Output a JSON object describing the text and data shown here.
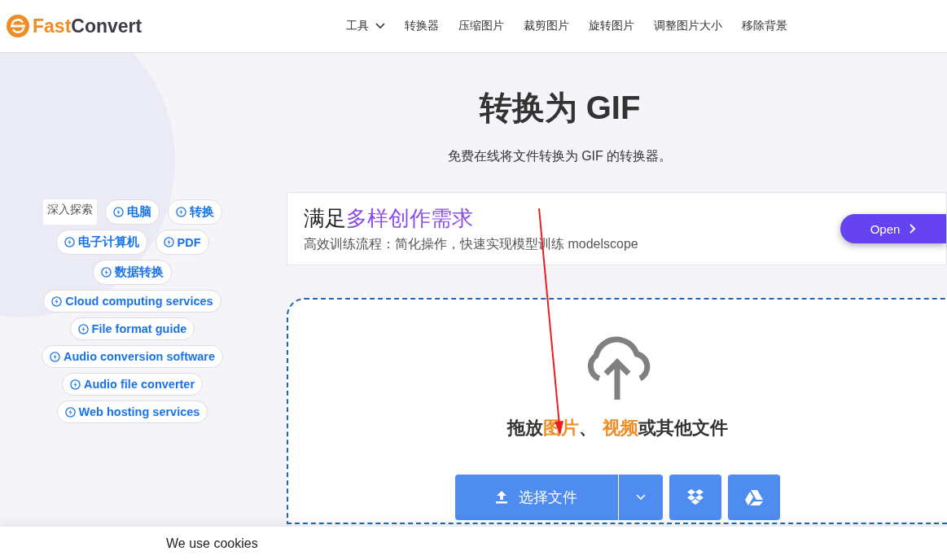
{
  "header": {
    "logo": {
      "part1": "Fast",
      "part2": "Convert"
    },
    "nav": [
      {
        "label": "工具",
        "dropdown": true
      },
      {
        "label": "转换器",
        "dropdown": false
      },
      {
        "label": "压缩图片",
        "dropdown": false
      },
      {
        "label": "裁剪图片",
        "dropdown": false
      },
      {
        "label": "旋转图片",
        "dropdown": false
      },
      {
        "label": "调整图片大小",
        "dropdown": false
      },
      {
        "label": "移除背景",
        "dropdown": false
      }
    ]
  },
  "explore": {
    "label": "深入探索",
    "tags": [
      "电脑",
      "转换",
      "电子计算机",
      "PDF",
      "数据转换",
      "Cloud computing services",
      "File format guide",
      "Audio conversion software",
      "Audio file converter",
      "Web hosting services"
    ]
  },
  "title": "转换为 GIF",
  "subtitle": "免费在线将文件转换为 GIF 的转换器。",
  "ad": {
    "headline": [
      {
        "text": "满足",
        "highlight": false
      },
      {
        "text": "多样创作需求",
        "highlight": true
      }
    ],
    "description": "高效训练流程：简化操作，快速实现模型训练 modelscope",
    "button": "Open"
  },
  "dropzone": {
    "text": [
      {
        "text": "拖放",
        "highlight": false
      },
      {
        "text": "图片",
        "highlight": true
      },
      {
        "text": "、 ",
        "highlight": false
      },
      {
        "text": "视频",
        "highlight": true
      },
      {
        "text": "或其他文件",
        "highlight": false
      }
    ],
    "choose_button": "选择文件"
  },
  "cookie_bar": {
    "text": "We use cookies"
  }
}
